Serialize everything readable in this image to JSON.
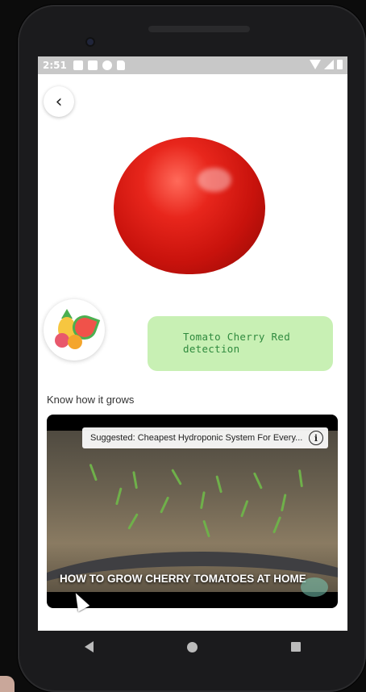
{
  "status_bar": {
    "time": "2:51"
  },
  "back_button": {
    "icon": "chevron-left-icon",
    "glyph": "‹"
  },
  "detection": {
    "label": "Tomato Cherry Red detection"
  },
  "section": {
    "title": "Know how it grows"
  },
  "video": {
    "suggestion": "Suggested: Cheapest Hydroponic System For Every...",
    "info_glyph": "i",
    "caption": "HOW TO GROW CHERRY TOMATOES AT HOME"
  },
  "colors": {
    "result_card_bg": "#c8f0b4",
    "result_text": "#2f8a3e",
    "tomato": "#e8261c"
  }
}
